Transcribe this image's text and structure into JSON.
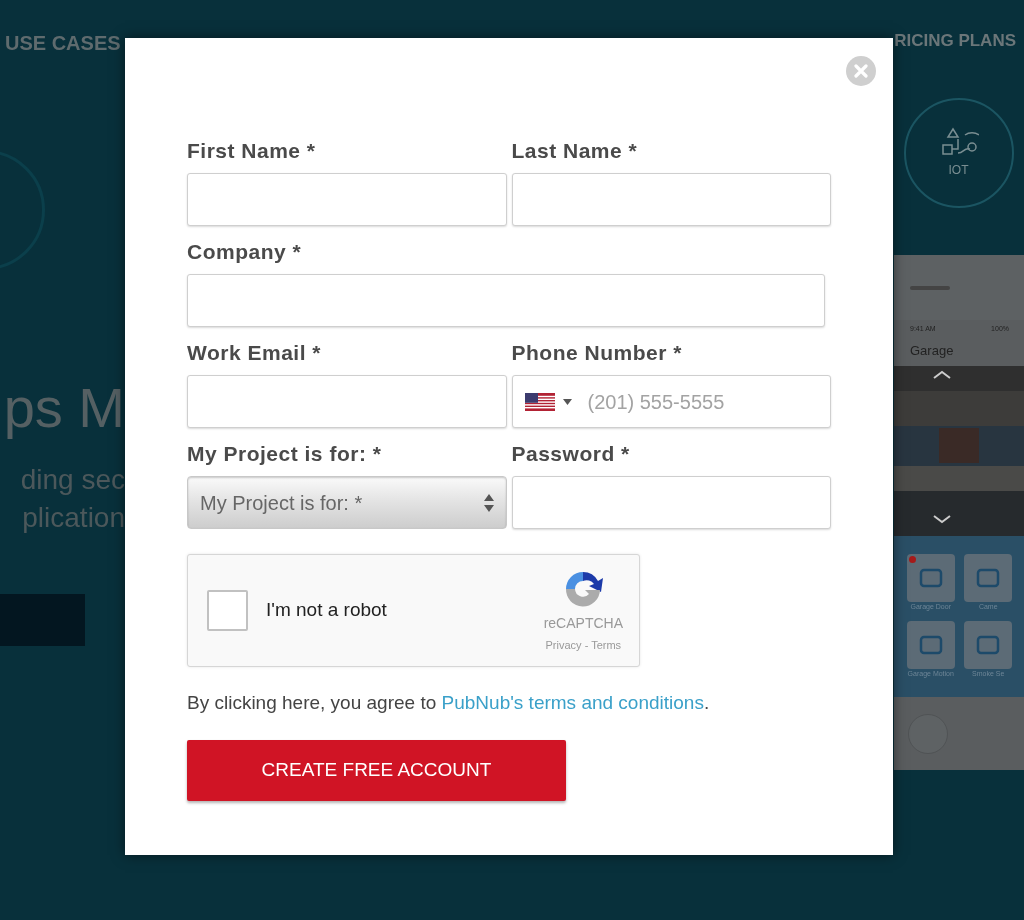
{
  "nav": [
    {
      "label": "USE CASES"
    },
    {
      "label": "RICING PLANS"
    }
  ],
  "hero": {
    "title": "ps M",
    "line_1": "ding sec",
    "line_2": "plication"
  },
  "iot_badge": {
    "label": "IOT"
  },
  "phone": {
    "time": "9:41 AM",
    "battery": "100%",
    "title": "Garage",
    "tiles": [
      {
        "label": "Garage Door",
        "alert": true
      },
      {
        "label": "Came",
        "alert": false
      },
      {
        "label": "Garage Motion",
        "alert": false
      },
      {
        "label": "Smoke Se",
        "alert": false
      }
    ]
  },
  "form": {
    "fields": [
      {
        "label": "First Name *",
        "kind": "text",
        "wide": false
      },
      {
        "label": "Last Name *",
        "kind": "text",
        "wide": false
      },
      {
        "label": "Company *",
        "kind": "text",
        "wide": true
      },
      {
        "label": "Work Email *",
        "kind": "text",
        "wide": false
      },
      {
        "label": "Phone Number *",
        "kind": "phone",
        "wide": false,
        "placeholder": "(201) 555-5555"
      },
      {
        "label": "My Project is for: *",
        "kind": "select",
        "wide": false,
        "value": "My Project is for: *"
      },
      {
        "label": "Password *",
        "kind": "password",
        "wide": false
      }
    ],
    "captcha": {
      "label": "I'm not a robot",
      "checked": false,
      "brand": "reCAPTCHA",
      "links": "Privacy - Terms"
    },
    "terms": {
      "before": "By clicking here, you agree to ",
      "link": "PubNub's terms and conditions",
      "after": "."
    },
    "submit": "CREATE FREE ACCOUNT"
  }
}
